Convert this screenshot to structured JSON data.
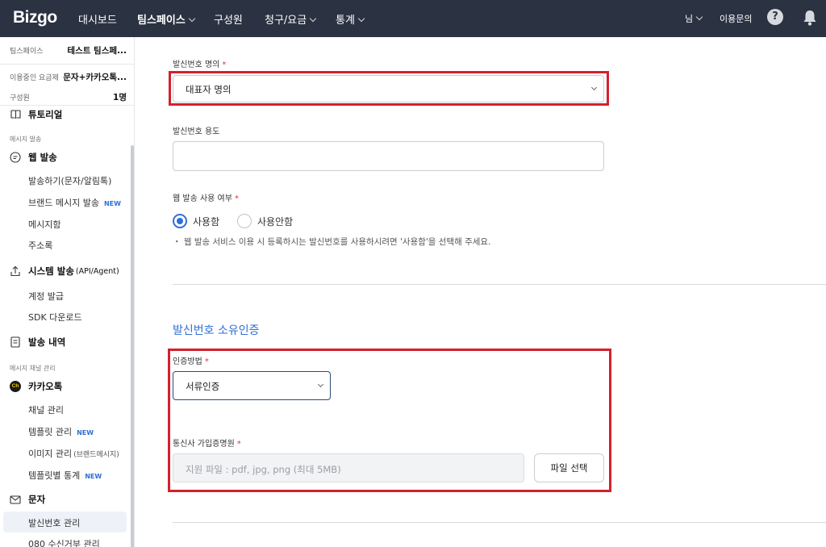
{
  "topnav": {
    "logo": "Bizgo",
    "items": [
      "대시보드",
      "팀스페이스",
      "구성원",
      "청구/요금",
      "통계"
    ],
    "user": "님",
    "support": "이용문의",
    "help_label": "?"
  },
  "sidebar": {
    "team_label": "팀스페이스",
    "team_value": "테스트 팀스페...",
    "plan_label": "이용중인 요금제",
    "plan_value": "문자+카카오톡...",
    "member_label": "구성원",
    "member_value": "1명",
    "tutorial": "튜토리얼",
    "section_send": "메시지 발송",
    "web_send": "웹 발송",
    "web_items": [
      "발송하기(문자/알림톡)",
      "브랜드 메시지 발송",
      "메시지함",
      "주소록"
    ],
    "system_send": "시스템 발송",
    "system_suffix": "(API/Agent)",
    "system_items": [
      "계정 발급",
      "SDK 다운로드"
    ],
    "history": "발송 내역",
    "section_channel": "메시지 채널 관리",
    "kakao": "카카오톡",
    "kakao_icon_text": "Ch",
    "kakao_items": [
      "채널 관리",
      "템플릿 관리",
      "이미지 관리",
      "템플릿별 통계"
    ],
    "image_suffix": "(브랜드메시지)",
    "new_badge": "NEW",
    "sms": "문자",
    "sms_items": [
      "발신번호 관리",
      "080 수신거부 관리"
    ]
  },
  "form": {
    "owner_label": "발신번호 명의",
    "owner_value": "대표자 명의",
    "usage_label": "발신번호 용도",
    "usage_value": "",
    "web_use_label": "웹 발송 사용 여부",
    "radio_use": "사용함",
    "radio_nouse": "사용안함",
    "hint": "・ 웹 발송 서비스 이용 시 등록하시는 발신번호를 사용하시려면 '사용함'을 선택해 주세요.",
    "section_title": "발신번호 소유인증",
    "auth_label": "인증방법",
    "auth_value": "서류인증",
    "cert_label": "통신사 가입증명원",
    "file_placeholder": "지원 파일 : pdf, jpg, png (최대 5MB)",
    "file_button": "파일 선택"
  }
}
